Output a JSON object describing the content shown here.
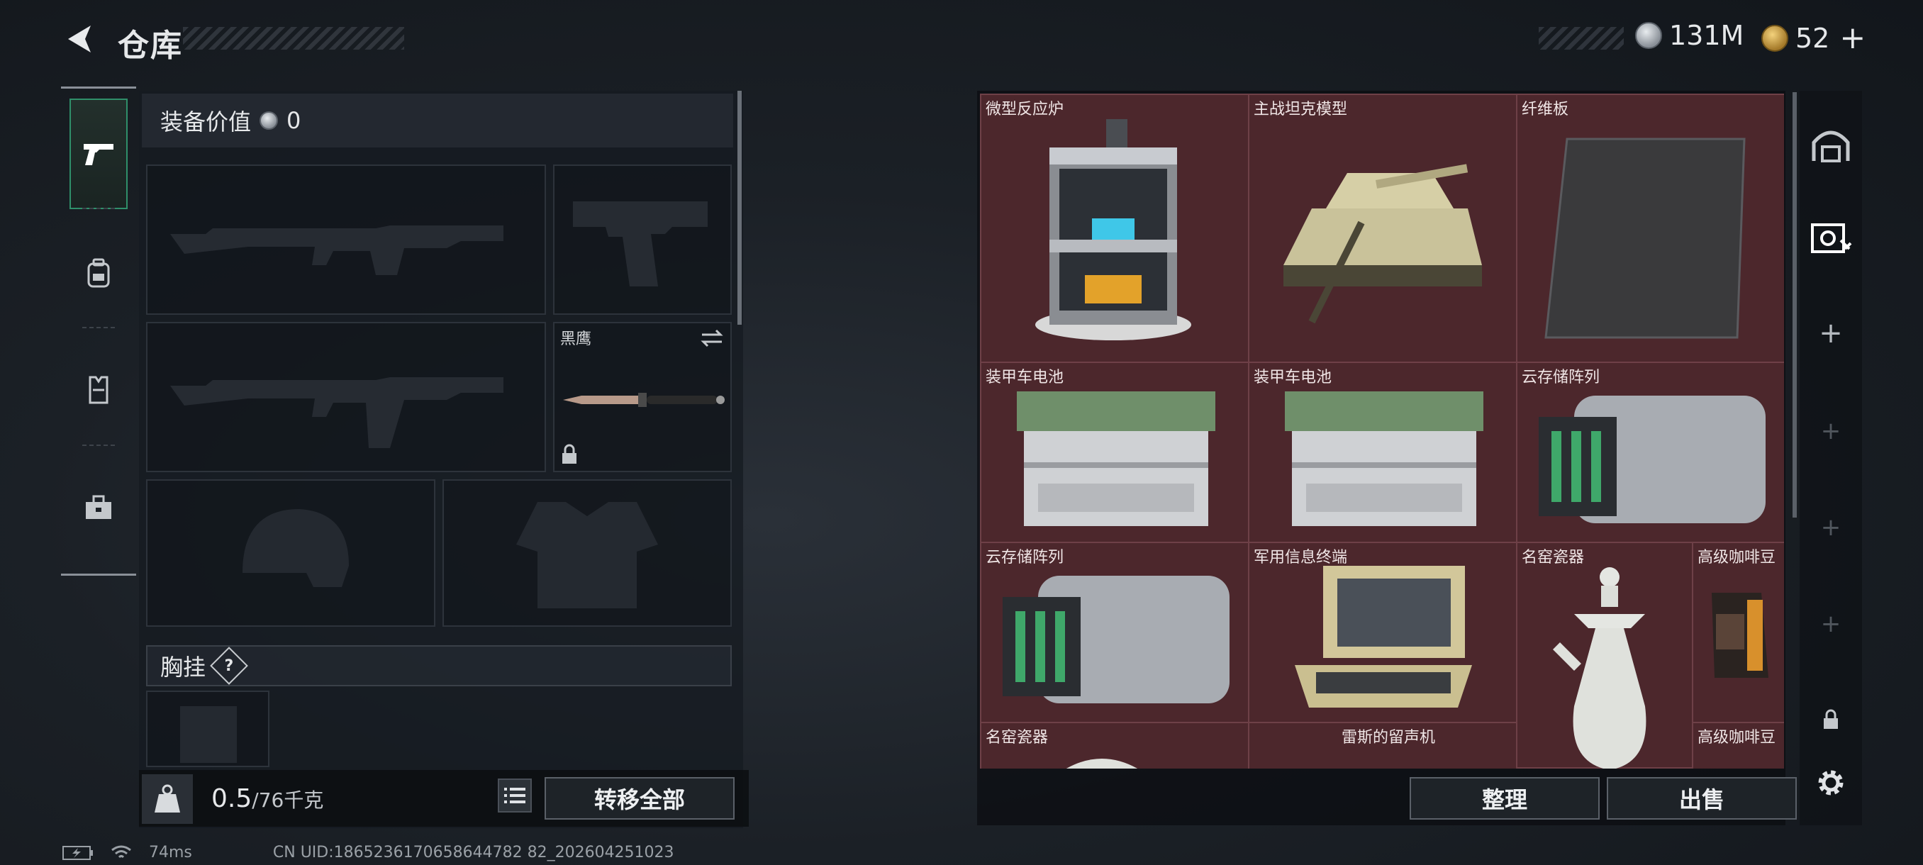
{
  "header": {
    "title": "仓库",
    "silver_amount": "131M",
    "gold_amount": "52",
    "plus": "+"
  },
  "nav": [
    "pistol-icon",
    "backpack-icon",
    "vest-icon",
    "toolbox-icon"
  ],
  "equipment": {
    "value_label": "装备价值",
    "value": "0",
    "knife_label": "黑鹰",
    "chest_rig_label": "胸挂",
    "chest_rig_help": "?"
  },
  "capacity": {
    "current": "0.5",
    "max": "/76千克"
  },
  "buttons": {
    "transfer_all": "转移全部",
    "organize": "整理",
    "sell": "出售"
  },
  "stash_items": [
    {
      "label": "微型反应炉"
    },
    {
      "label": "主战坦克模型"
    },
    {
      "label": "纤维板"
    },
    {
      "label": "装甲车电池"
    },
    {
      "label": "装甲车电池"
    },
    {
      "label": "云存储阵列"
    },
    {
      "label": "云存储阵列"
    },
    {
      "label": "军用信息终端"
    },
    {
      "label": "名窑瓷器"
    },
    {
      "label": "高级咖啡豆"
    },
    {
      "label": "名窑瓷器"
    },
    {
      "label": "雷斯的留声机"
    },
    {
      "label": "高级咖啡豆"
    }
  ],
  "status": {
    "ping": "74ms",
    "uid": "CN UID:1865236170658644782 82_202604251023"
  },
  "colors": {
    "accent_green": "#2f8f6a",
    "grid_bg": "#4a252b",
    "grid_line": "#6e4047"
  }
}
